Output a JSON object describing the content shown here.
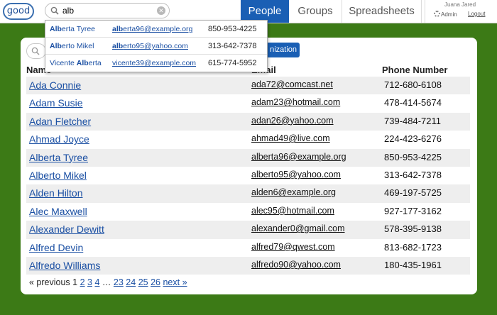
{
  "header": {
    "logo_text": "good",
    "search": {
      "value": "alb"
    },
    "tabs": [
      {
        "label": "People",
        "active": true
      },
      {
        "label": "Groups",
        "active": false
      },
      {
        "label": "Spreadsheets",
        "active": false
      }
    ],
    "user": {
      "name": "Juana Jared",
      "admin_label": "Admin",
      "logout_label": "Logout"
    }
  },
  "suggestions": [
    {
      "name_match": "Alb",
      "name_rest": "erta Tyree",
      "email_match": "alb",
      "email_rest": "erta96@example.org",
      "phone": "850-953-4225"
    },
    {
      "name_match": "Alb",
      "name_rest": "erto Mikel",
      "email_match": "alb",
      "email_rest": "erto95@yahoo.com",
      "phone": "313-642-7378"
    },
    {
      "name_prefix": "Vicente ",
      "name_match": "Alb",
      "name_rest": "erta",
      "email": "vicente39@example.com",
      "phone": "615-774-5952"
    }
  ],
  "toolbar": {
    "org_button_label": "nization"
  },
  "table": {
    "columns": {
      "name": "Name",
      "email": "Email",
      "phone": "Phone Number"
    },
    "rows": [
      {
        "name": "Ada Connie",
        "email": "ada72@comcast.net",
        "phone": "712-680-6108"
      },
      {
        "name": "Adam Susie",
        "email": "adam23@hotmail.com",
        "phone": "478-414-5674"
      },
      {
        "name": "Adan Fletcher",
        "email": "adan26@yahoo.com",
        "phone": "739-484-7211"
      },
      {
        "name": "Ahmad Joyce",
        "email": "ahmad49@live.com",
        "phone": "224-423-6276"
      },
      {
        "name": "Alberta Tyree",
        "email": "alberta96@example.org",
        "phone": "850-953-4225"
      },
      {
        "name": "Alberto Mikel",
        "email": "alberto95@yahoo.com",
        "phone": "313-642-7378"
      },
      {
        "name": "Alden Hilton",
        "email": "alden6@example.org",
        "phone": "469-197-5725"
      },
      {
        "name": "Alec Maxwell",
        "email": "alec95@hotmail.com",
        "phone": "927-177-3162"
      },
      {
        "name": "Alexander Dewitt",
        "email": "alexander0@gmail.com",
        "phone": "578-395-9138"
      },
      {
        "name": "Alfred Devin",
        "email": "alfred79@qwest.com",
        "phone": "813-682-1723"
      },
      {
        "name": "Alfredo Williams",
        "email": "alfredo90@yahoo.com",
        "phone": "180-435-1961"
      }
    ]
  },
  "pagination": {
    "previous_label": "« previous",
    "current": "1",
    "pages": [
      "2",
      "3",
      "4"
    ],
    "ellipsis": "…",
    "last_pages": [
      "23",
      "24",
      "25",
      "26"
    ],
    "next_label": "next »"
  },
  "colors": {
    "background": "#3c7a16",
    "accent": "#1a5fb4",
    "link": "#1a4fa3"
  }
}
